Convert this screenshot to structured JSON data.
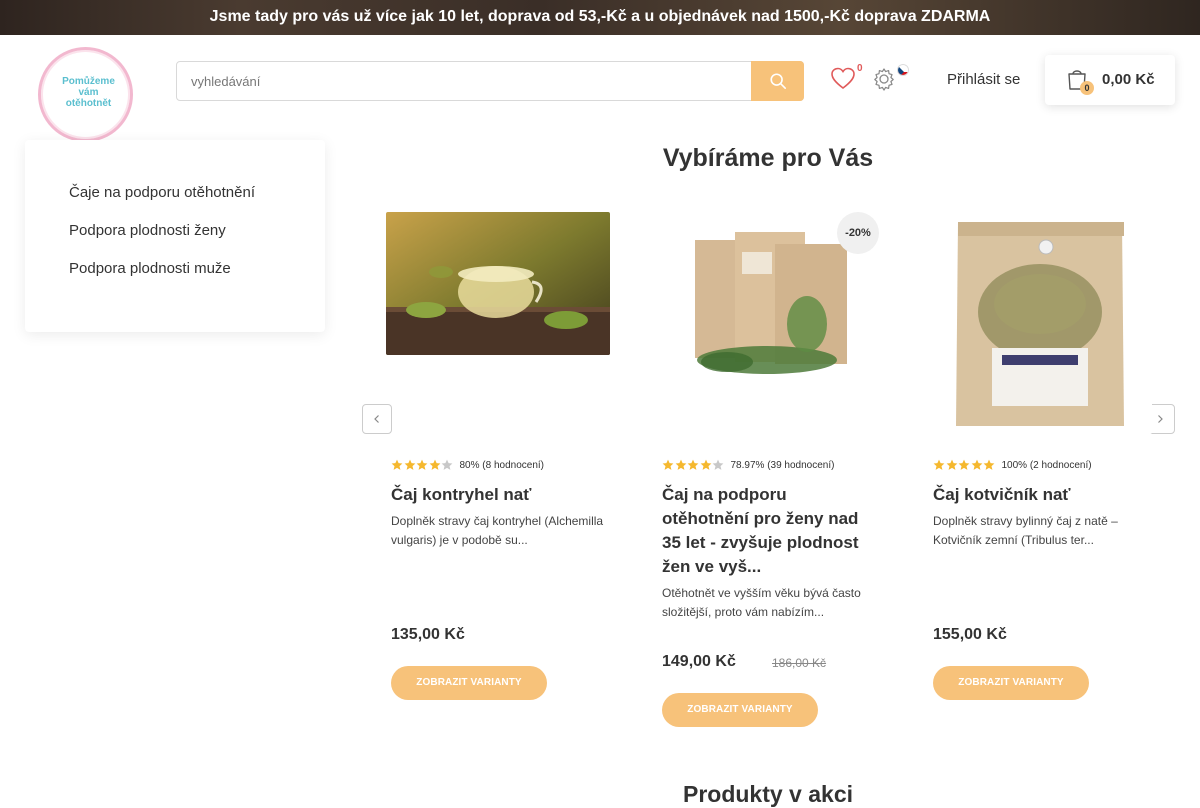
{
  "banner": {
    "text": "Jsme tady pro vás už více jak 10 let, doprava od 53,-Kč a u objednávek nad 1500,-Kč doprava ZDARMA"
  },
  "logo": {
    "line1": "Pomůžeme",
    "line2": "vám",
    "line3": "otěhotnět"
  },
  "search": {
    "placeholder": "vyhledávání"
  },
  "header": {
    "wishlist_count": "0",
    "login_label": "Přihlásit se",
    "cart_count": "0",
    "cart_total": "0,00 Kč"
  },
  "sidebar": {
    "items": [
      {
        "label": "Čaje na podporu otěhotnění"
      },
      {
        "label": "Podpora plodnosti ženy"
      },
      {
        "label": "Podpora plodnosti muže"
      }
    ]
  },
  "main": {
    "section_title": "Vybíráme pro Vás",
    "next_section_title": "Produkty v akci",
    "products": [
      {
        "name": "Čaj kontryhel nať",
        "rating_text": "80% (8 hodnocení)",
        "stars": 4,
        "desc": "Doplněk stravy čaj kontryhel (Alchemilla vulgaris) je v podobě su...",
        "price": "135,00 Kč",
        "old_price": "",
        "discount": "",
        "button": "ZOBRAZIT VARIANTY"
      },
      {
        "name": "Čaj na podporu otěhotnění pro ženy nad 35 let - zvyšuje plodnost žen ve vyš...",
        "rating_text": "78.97% (39 hodnocení)",
        "stars": 4,
        "desc": "Otěhotnět ve vyšším věku bývá často složitější, proto vám nabízím...",
        "price": "149,00 Kč",
        "old_price": "186,00 Kč",
        "discount": "-20%",
        "button": "ZOBRAZIT VARIANTY"
      },
      {
        "name": "Čaj kotvičník nať",
        "rating_text": "100% (2 hodnocení)",
        "stars": 5,
        "desc": "Doplněk stravy bylinný čaj z natě – Kotvičník zemní (Tribulus ter...",
        "price": "155,00 Kč",
        "old_price": "",
        "discount": "",
        "button": "ZOBRAZIT VARIANTY"
      }
    ]
  },
  "colors": {
    "accent": "#f7c27a",
    "star": "#f5b82e",
    "star_empty": "#c8c8c8",
    "logo_pink": "#f2b8cf",
    "logo_teal": "#5bbfcf"
  }
}
